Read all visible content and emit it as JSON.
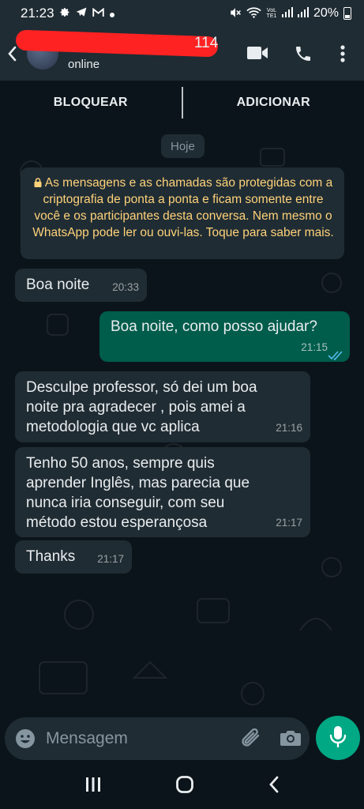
{
  "status_bar": {
    "time": "21:23",
    "notification_icons": [
      "gear-icon",
      "telegram-icon",
      "gmail-icon",
      "dot-icon"
    ],
    "right_icons": [
      "mute-icon",
      "wifi-icon",
      "volte-icon",
      "signal-icon",
      "signal-icon"
    ],
    "volte_label": "VoLTE1",
    "battery": "20%"
  },
  "header": {
    "contact_suffix": "114",
    "status": "online",
    "icons": [
      "back-icon",
      "video-call-icon",
      "phone-icon",
      "more-vert-icon"
    ]
  },
  "actions": {
    "block_label": "BLOQUEAR",
    "add_label": "ADICIONAR"
  },
  "chat": {
    "date_label": "Hoje",
    "encryption_notice": "As mensagens e as chamadas são protegidas com a criptografia de ponta a ponta e ficam somente entre você e os participantes desta conversa. Nem mesmo o WhatsApp pode ler ou ouvi-las. Toque para saber mais.",
    "messages": [
      {
        "direction": "in",
        "text": "Boa noite",
        "time": "20:33"
      },
      {
        "direction": "out",
        "text": "Boa noite, como posso ajudar?",
        "time": "21:15",
        "status": "read"
      },
      {
        "direction": "in",
        "text": "Desculpe professor, só dei um boa\nnoite pra agradecer , pois amei a\nmetodologia que vc aplica",
        "time": "21:16"
      },
      {
        "direction": "in",
        "text": "Tenho 50 anos, sempre quis\naprender Inglês, mas parecia que\nnunca iria conseguir, com seu\nmétodo estou esperançosa",
        "time": "21:17"
      },
      {
        "direction": "in",
        "text": "Thanks",
        "time": "21:17"
      }
    ]
  },
  "input": {
    "placeholder": "Mensagem",
    "value": ""
  },
  "colors": {
    "header_bg": "#1f2c34",
    "chat_bg": "#0b141a",
    "incoming_bubble": "#202c33",
    "outgoing_bubble": "#005c4b",
    "accent": "#00a884",
    "read_ticks": "#53bdeb",
    "notice_text": "#ffd279",
    "redaction": "#ff2222"
  }
}
